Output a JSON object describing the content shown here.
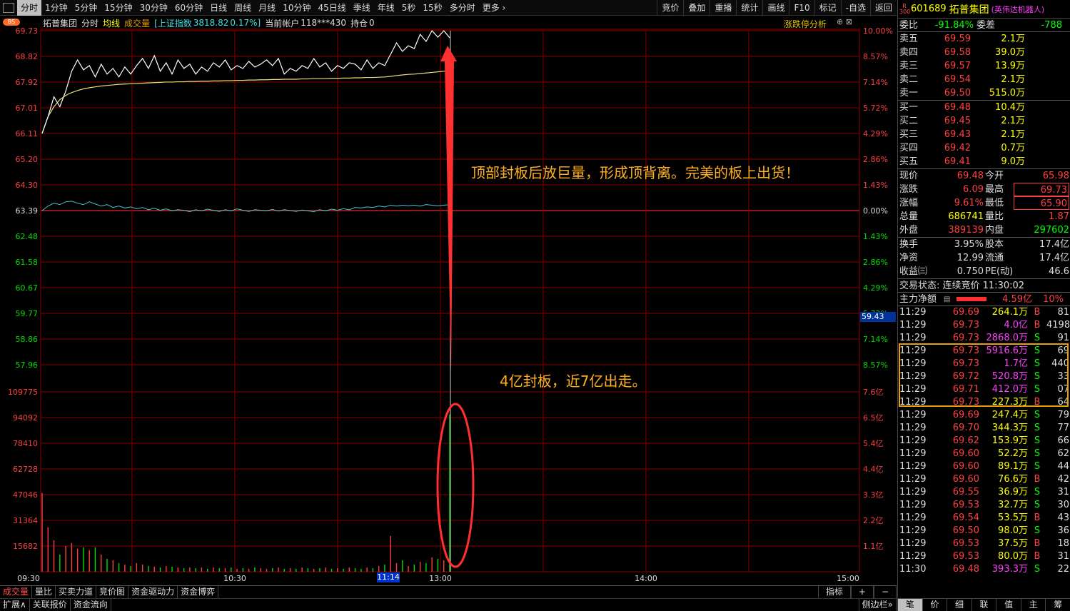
{
  "toolbar": {
    "tabs": [
      "分时",
      "1分钟",
      "5分钟",
      "15分钟",
      "30分钟",
      "60分钟",
      "日线",
      "周线",
      "月线",
      "10分钟",
      "45日线",
      "季线",
      "年线",
      "5秒",
      "15秒",
      "多分时",
      "更多 ›"
    ],
    "active_tab": "分时",
    "tools": [
      "竞价",
      "叠加",
      "重播",
      "统计",
      "画线",
      "F10",
      "标记",
      "-自选",
      "返回"
    ]
  },
  "info_bar": {
    "stock_name": "拓普集团",
    "mode": "分时",
    "avg_label": "均线",
    "vol_label": "成交量",
    "index_name": "[上证指数",
    "index_value": "3818.82",
    "index_change": "0.17%]",
    "account_label": "当前帐户",
    "account": "118***430",
    "position_label": "持仓",
    "position": "0",
    "bs_badge": "BS",
    "limit_analysis": "涨跌停分析",
    "ctl_icons": "⊕  ⊠"
  },
  "annotations": {
    "top": "顶部封板后放巨量，形成顶背离。完美的板上出货！",
    "bottom": "4亿封板，近7亿出走。"
  },
  "time_flag": "11:14",
  "price_tag": "59.43",
  "chart_data": {
    "type": "line",
    "price_axis": {
      "ticks": [
        "69.73",
        "68.82",
        "67.92",
        "67.01",
        "66.11",
        "65.20",
        "64.30",
        "63.39",
        "62.48",
        "61.58",
        "60.67",
        "59.77",
        "58.86",
        "57.96"
      ],
      "pct_ticks": [
        "10.00%",
        "8.57%",
        "7.14%",
        "5.72%",
        "4.29%",
        "2.86%",
        "1.43%",
        "0.00%",
        "1.43%",
        "2.86%",
        "4.29%",
        "5.72%",
        "7.14%",
        "8.57%"
      ],
      "ylim": [
        57.05,
        69.73
      ],
      "prev_close": 63.39
    },
    "volume_axis": {
      "ticks": [
        "109775",
        "94092",
        "78410",
        "62728",
        "47046",
        "31364",
        "15682"
      ],
      "amount_ticks": [
        "7.6亿",
        "6.5亿",
        "5.4亿",
        "4.4亿",
        "3.3亿",
        "2.2亿",
        "1.1亿"
      ],
      "ylim": [
        0,
        125457
      ]
    },
    "x_ticks": [
      "09:30",
      "10:30",
      "13:00",
      "14:00",
      "15:00"
    ],
    "price_series": [
      66.11,
      66.7,
      67.4,
      67.05,
      67.6,
      68.3,
      68.7,
      68.35,
      68.5,
      68.1,
      68.55,
      68.2,
      68.4,
      68.1,
      68.45,
      68.2,
      68.5,
      68.75,
      68.4,
      68.85,
      68.3,
      68.6,
      68.2,
      68.7,
      68.4,
      68.55,
      68.2,
      68.45,
      68.3,
      68.6,
      68.45,
      68.7,
      68.35,
      68.5,
      68.4,
      68.65,
      68.45,
      68.55,
      68.7,
      68.5,
      68.75,
      68.2,
      68.4,
      68.3,
      68.5,
      68.4,
      68.75,
      68.45,
      68.6,
      68.3,
      68.5,
      68.4,
      68.6,
      68.55,
      68.35,
      68.7,
      68.4,
      68.6,
      68.5,
      68.9,
      69.3,
      69.0,
      69.2,
      69.1,
      69.6,
      69.35,
      69.73,
      69.5,
      69.73,
      69.48
    ],
    "avg_series": [
      66.11,
      66.7,
      67.05,
      67.3,
      67.45,
      67.55,
      67.62,
      67.68,
      67.72,
      67.75,
      67.78,
      67.8,
      67.82,
      67.84,
      67.85,
      67.86,
      67.87,
      67.88,
      67.89,
      67.9,
      67.91,
      67.92,
      67.92,
      67.93,
      67.93,
      67.94,
      67.94,
      67.95,
      67.95,
      67.96,
      67.96,
      67.97,
      67.97,
      67.98,
      67.98,
      67.99,
      67.99,
      68.0,
      68.0,
      68.01,
      68.01,
      68.02,
      68.02,
      68.02,
      68.03,
      68.03,
      68.04,
      68.04,
      68.04,
      68.05,
      68.05,
      68.06,
      68.06,
      68.07,
      68.07,
      68.08,
      68.08,
      68.09,
      68.1,
      68.12,
      68.15,
      68.17,
      68.19,
      68.2,
      68.22,
      68.24,
      68.26,
      68.28,
      68.3,
      68.33
    ],
    "index_series": [
      63.39,
      63.55,
      63.65,
      63.6,
      63.7,
      63.72,
      63.65,
      63.6,
      63.7,
      63.62,
      63.55,
      63.6,
      63.5,
      63.55,
      63.48,
      63.52,
      63.45,
      63.5,
      63.42,
      63.47,
      63.4,
      63.45,
      63.38,
      63.42,
      63.4,
      63.35,
      63.42,
      63.38,
      63.44,
      63.4,
      63.36,
      63.42,
      63.38,
      63.45,
      63.4,
      63.36,
      63.42,
      63.4,
      63.38,
      63.43,
      63.37,
      63.42,
      63.39,
      63.36,
      63.41,
      63.38,
      63.35,
      63.42,
      63.38,
      63.44,
      63.4,
      63.46,
      63.42,
      63.5,
      63.48,
      63.52,
      63.5,
      63.55,
      63.52,
      63.58,
      63.55,
      63.58,
      63.56,
      63.58,
      63.55,
      63.6,
      63.58,
      63.56,
      63.58,
      63.6
    ],
    "volume_series": [
      55000,
      31000,
      22000,
      12000,
      18000,
      20000,
      16000,
      17000,
      15000,
      17000,
      12000,
      9000,
      8000,
      6000,
      5000,
      4000,
      6000,
      5000,
      4000,
      3500,
      3000,
      4000,
      3500,
      3000,
      2500,
      3000,
      2500,
      3000,
      2000,
      3000,
      2500,
      2500,
      3000,
      2000,
      2500,
      2000,
      3000,
      2500,
      2000,
      2500,
      3000,
      2000,
      2500,
      2000,
      3000,
      2500,
      2000,
      2500,
      3000,
      2000,
      2500,
      2000,
      3000,
      2500,
      2000,
      3000,
      2500,
      4000,
      5000,
      25000,
      6000,
      8000,
      4000,
      5000,
      7000,
      6000,
      10000,
      9000,
      8000,
      109775
    ]
  },
  "quote": {
    "code": "601689",
    "name": "拓普集团",
    "tag": "(英伟达机器人)",
    "badge_r": "R",
    "badge_300": "300",
    "ratio_label": "委比",
    "ratio": "-91.84%",
    "diff_label": "委差",
    "diff": "-788",
    "sells": [
      {
        "label": "卖五",
        "price": "69.59",
        "vol": "2.1万"
      },
      {
        "label": "卖四",
        "price": "69.58",
        "vol": "39.0万"
      },
      {
        "label": "卖三",
        "price": "69.57",
        "vol": "13.9万"
      },
      {
        "label": "卖二",
        "price": "69.54",
        "vol": "2.1万"
      },
      {
        "label": "卖一",
        "price": "69.50",
        "vol": "515.0万"
      }
    ],
    "buys": [
      {
        "label": "买一",
        "price": "69.48",
        "vol": "10.4万"
      },
      {
        "label": "买二",
        "price": "69.45",
        "vol": "2.1万"
      },
      {
        "label": "买三",
        "price": "69.43",
        "vol": "2.1万"
      },
      {
        "label": "买四",
        "price": "69.42",
        "vol": "0.7万"
      },
      {
        "label": "买五",
        "price": "69.41",
        "vol": "9.0万"
      }
    ],
    "stats": [
      {
        "l1": "现价",
        "v1": "69.48",
        "c1": "red",
        "l2": "今开",
        "v2": "65.98",
        "c2": "red"
      },
      {
        "l1": "涨跌",
        "v1": "6.09",
        "c1": "red",
        "l2": "最高",
        "v2": "69.73",
        "c2": "red"
      },
      {
        "l1": "涨幅",
        "v1": "9.61%",
        "c1": "red",
        "l2": "最低",
        "v2": "65.90",
        "c2": "red"
      },
      {
        "l1": "总量",
        "v1": "686741",
        "c1": "yellow",
        "l2": "量比",
        "v2": "1.87",
        "c2": "red"
      },
      {
        "l1": "外盘",
        "v1": "389139",
        "c1": "red",
        "l2": "内盘",
        "v2": "297602",
        "c2": "green"
      }
    ],
    "stats2": [
      {
        "l1": "换手",
        "v1": "3.95%",
        "l2": "股本",
        "v2": "17.4亿"
      },
      {
        "l1": "净资",
        "v1": "12.99",
        "l2": "流通",
        "v2": "17.4亿"
      },
      {
        "l1": "收益㈢",
        "v1": "0.750",
        "l2": "PE(动)",
        "v2": "46.6"
      }
    ],
    "trade_status": "交易状态: 连续竞价 11:30:02",
    "main_net_label": "主力净额",
    "main_net": "4.59亿",
    "main_net_pct": "10%"
  },
  "ticks": [
    {
      "t": "11:29",
      "p": "69.69",
      "v": "264.1万",
      "d": "B",
      "n": "81",
      "pc": "red",
      "vc": "yellow",
      "dc": "red"
    },
    {
      "t": "11:29",
      "p": "69.73",
      "v": "4.0亿",
      "d": "B",
      "n": "4198",
      "pc": "red",
      "vc": "mag",
      "dc": "red"
    },
    {
      "t": "11:29",
      "p": "69.73",
      "v": "2868.0万",
      "d": "S",
      "n": "91",
      "pc": "red",
      "vc": "mag",
      "dc": "green"
    },
    {
      "t": "11:29",
      "p": "69.73",
      "v": "5916.6万",
      "d": "S",
      "n": "69",
      "pc": "red",
      "vc": "mag",
      "dc": "green"
    },
    {
      "t": "11:29",
      "p": "69.73",
      "v": "1.7亿",
      "d": "S",
      "n": "440",
      "pc": "red",
      "vc": "mag",
      "dc": "green"
    },
    {
      "t": "11:29",
      "p": "69.72",
      "v": "520.8万",
      "d": "S",
      "n": "33",
      "pc": "red",
      "vc": "mag",
      "dc": "green"
    },
    {
      "t": "11:29",
      "p": "69.71",
      "v": "412.0万",
      "d": "S",
      "n": "07",
      "pc": "red",
      "vc": "mag",
      "dc": "green"
    },
    {
      "t": "11:29",
      "p": "69.73",
      "v": "227.3万",
      "d": "B",
      "n": "64",
      "pc": "red",
      "vc": "yellow",
      "dc": "red"
    },
    {
      "t": "11:29",
      "p": "69.69",
      "v": "247.4万",
      "d": "S",
      "n": "79",
      "pc": "red",
      "vc": "yellow",
      "dc": "green"
    },
    {
      "t": "11:29",
      "p": "69.70",
      "v": "344.3万",
      "d": "S",
      "n": "77",
      "pc": "red",
      "vc": "yellow",
      "dc": "green"
    },
    {
      "t": "11:29",
      "p": "69.62",
      "v": "153.9万",
      "d": "S",
      "n": "66",
      "pc": "red",
      "vc": "yellow",
      "dc": "green"
    },
    {
      "t": "11:29",
      "p": "69.60",
      "v": "52.2万",
      "d": "S",
      "n": "62",
      "pc": "red",
      "vc": "yellow",
      "dc": "green"
    },
    {
      "t": "11:29",
      "p": "69.60",
      "v": "89.1万",
      "d": "S",
      "n": "44",
      "pc": "red",
      "vc": "yellow",
      "dc": "green"
    },
    {
      "t": "11:29",
      "p": "69.60",
      "v": "76.6万",
      "d": "B",
      "n": "42",
      "pc": "red",
      "vc": "yellow",
      "dc": "red"
    },
    {
      "t": "11:29",
      "p": "69.55",
      "v": "36.9万",
      "d": "S",
      "n": "31",
      "pc": "red",
      "vc": "yellow",
      "dc": "green"
    },
    {
      "t": "11:29",
      "p": "69.53",
      "v": "32.7万",
      "d": "S",
      "n": "30",
      "pc": "red",
      "vc": "yellow",
      "dc": "green"
    },
    {
      "t": "11:29",
      "p": "69.54",
      "v": "53.5万",
      "d": "B",
      "n": "43",
      "pc": "red",
      "vc": "yellow",
      "dc": "red"
    },
    {
      "t": "11:29",
      "p": "69.50",
      "v": "98.0万",
      "d": "S",
      "n": "36",
      "pc": "red",
      "vc": "yellow",
      "dc": "green"
    },
    {
      "t": "11:29",
      "p": "69.53",
      "v": "37.5万",
      "d": "B",
      "n": "18",
      "pc": "red",
      "vc": "yellow",
      "dc": "red"
    },
    {
      "t": "11:29",
      "p": "69.53",
      "v": "80.0万",
      "d": "B",
      "n": "31",
      "pc": "red",
      "vc": "yellow",
      "dc": "red"
    },
    {
      "t": "11:30",
      "p": "69.48",
      "v": "393.3万",
      "d": "S",
      "n": "22",
      "pc": "red",
      "vc": "mag",
      "dc": "green"
    }
  ],
  "bottom_tabs": [
    "成交量",
    "量比",
    "买卖力道",
    "竞价图",
    "资金驱动力",
    "资金博弈"
  ],
  "bottom_right": [
    "指标",
    "+",
    "−"
  ],
  "status_left": [
    "扩展∧",
    "关联报价",
    "资金流向"
  ],
  "status_right": "侧边栏»",
  "right_bottom_tabs": [
    "笔",
    "价",
    "细",
    "联",
    "值",
    "主",
    "筹"
  ],
  "colors": {
    "up": "#ff4040",
    "down": "#00ff00",
    "grid": "#8b0000",
    "price_line": "#ffffff",
    "avg_line": "#e8e070",
    "index_line": "#40c8d0",
    "arrow": "#ff3030",
    "annotation": "#ffb020"
  }
}
